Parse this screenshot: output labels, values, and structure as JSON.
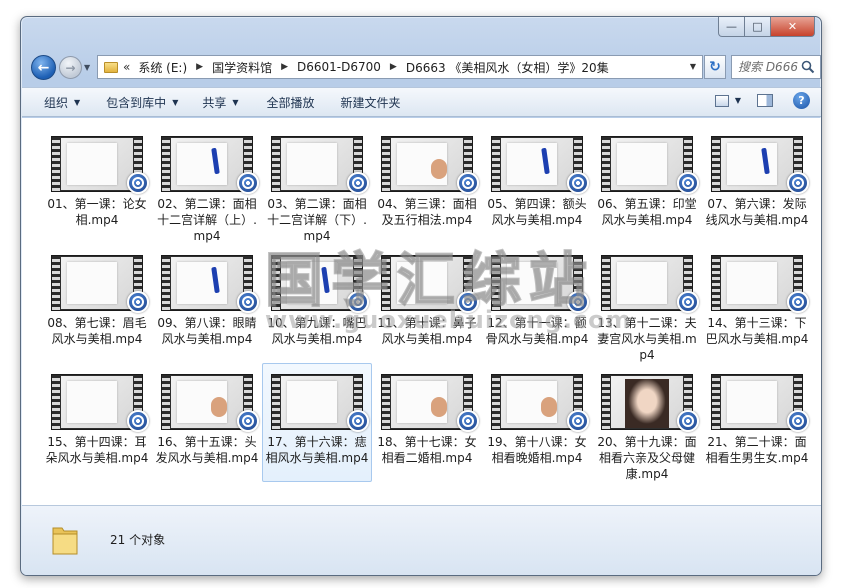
{
  "window": {
    "caption_min": "—",
    "caption_max": "□",
    "caption_close": "✕"
  },
  "nav": {
    "back_icon": "←",
    "forward_icon": "→",
    "chevron": "«",
    "breadcrumbs": [
      "系统 (E:)",
      "国学资料馆",
      "D6601-D6700",
      "D6663 《美相风水（女相）学》20集"
    ],
    "search_placeholder": "搜索 D666..."
  },
  "toolbar": {
    "organize": "组织",
    "include_library": "包含到库中",
    "share": "共享",
    "play_all": "全部播放",
    "new_folder": "新建文件夹",
    "help": "?"
  },
  "files": [
    {
      "name": "01、第一课：论女相.mp4",
      "thumb": "board"
    },
    {
      "name": "02、第二课：面相十二宫详解（上）.mp4",
      "thumb": "board-pen"
    },
    {
      "name": "03、第二课：面相十二宫详解（下）.mp4",
      "thumb": "board"
    },
    {
      "name": "04、第三课：面相及五行相法.mp4",
      "thumb": "board-hand"
    },
    {
      "name": "05、第四课：额头风水与美相.mp4",
      "thumb": "board-pen"
    },
    {
      "name": "06、第五课：印堂风水与美相.mp4",
      "thumb": "board"
    },
    {
      "name": "07、第六课：发际线风水与美相.mp4",
      "thumb": "board-pen"
    },
    {
      "name": "08、第七课：眉毛风水与美相.mp4",
      "thumb": "board"
    },
    {
      "name": "09、第八课：眼睛风水与美相.mp4",
      "thumb": "board-pen"
    },
    {
      "name": "10、第九课：嘴巴风水与美相.mp4",
      "thumb": "board-pen"
    },
    {
      "name": "11、第十课：鼻子风水与美相.mp4",
      "thumb": "board"
    },
    {
      "name": "12、第十一课：颧骨风水与美相.mp4",
      "thumb": "board"
    },
    {
      "name": "13、第十二课：夫妻宫风水与美相.mp4",
      "thumb": "board"
    },
    {
      "name": "14、第十三课：下巴风水与美相.mp4",
      "thumb": "board"
    },
    {
      "name": "15、第十四课：耳朵风水与美相.mp4",
      "thumb": "board"
    },
    {
      "name": "16、第十五课：头发风水与美相.mp4",
      "thumb": "board-hand"
    },
    {
      "name": "17、第十六课：痣相风水与美相.mp4",
      "thumb": "board"
    },
    {
      "name": "18、第十七课：女相看二婚相.mp4",
      "thumb": "board-hand"
    },
    {
      "name": "19、第十八课：女相看晚婚相.mp4",
      "thumb": "board-hand"
    },
    {
      "name": "20、第十九课：面相看六亲及父母健康.mp4",
      "thumb": "portrait"
    },
    {
      "name": "21、第二十课：面相看生男生女.mp4",
      "thumb": "board"
    }
  ],
  "selected_index": 16,
  "watermark": {
    "cn": "国学汇综站",
    "url": "www.guoxuehuizong.com"
  },
  "status": {
    "count_text": "21 个对象"
  },
  "colors": {
    "window_chrome": "#b8cde8",
    "selection": "#e4f0fc",
    "badge_blue": "#1a3f86"
  }
}
